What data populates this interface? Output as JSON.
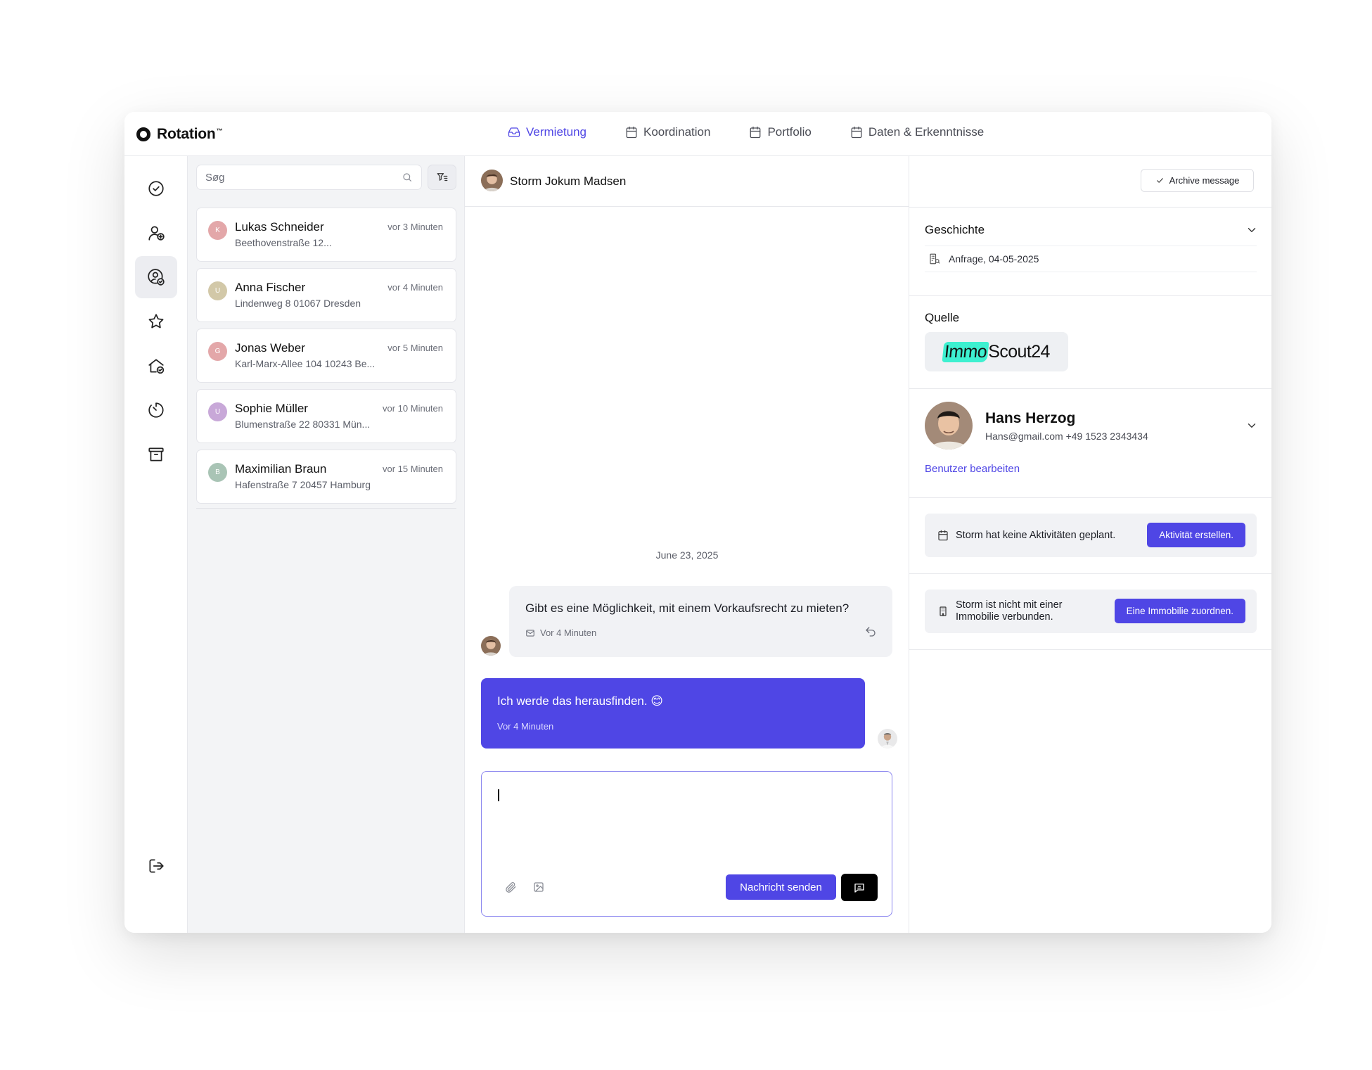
{
  "app": {
    "name": "Rotation",
    "trademark": "™"
  },
  "nav": {
    "tabs": [
      {
        "label": "Vermietung",
        "icon": "inbox-icon",
        "active": true
      },
      {
        "label": "Koordination",
        "icon": "calendar-icon",
        "active": false
      },
      {
        "label": "Portfolio",
        "icon": "calendar-icon",
        "active": false
      },
      {
        "label": "Daten & Erkenntnisse",
        "icon": "calendar-icon",
        "active": false
      }
    ]
  },
  "rail": {
    "icons": [
      "check-circle-icon",
      "user-add-icon",
      "user-check-icon",
      "star-icon",
      "home-check-icon",
      "timer-icon",
      "archive-icon",
      "logout-icon"
    ],
    "active_index": 2
  },
  "search": {
    "placeholder": "Søg"
  },
  "conversations": [
    {
      "initial": "K",
      "avatar_color": "#e3a7a9",
      "name": "Lukas Schneider",
      "address": "Beethovenstraße 12...",
      "time": "vor 3 Minuten"
    },
    {
      "initial": "U",
      "avatar_color": "#d2c8a8",
      "name": "Anna Fischer",
      "address": "Lindenweg 8 01067 Dresden",
      "time": "vor 4 Minuten"
    },
    {
      "initial": "G",
      "avatar_color": "#e3a7a9",
      "name": "Jonas Weber",
      "address": "Karl-Marx-Allee 104 10243 Be...",
      "time": "vor 5 Minuten"
    },
    {
      "initial": "U",
      "avatar_color": "#c8a8d8",
      "name": "Sophie Müller",
      "address": "Blumenstraße 22 80331 Mün...",
      "time": "vor 10 Minuten"
    },
    {
      "initial": "B",
      "avatar_color": "#a9c4b5",
      "name": "Maximilian Braun",
      "address": "Hafenstraße 7 20457 Hamburg",
      "time": "vor 15 Minuten"
    }
  ],
  "chat": {
    "contact_name": "Storm Jokum Madsen",
    "archive_label": "Archive message",
    "date": "June 23, 2025",
    "incoming": {
      "text": "Gibt es eine Möglichkeit, mit einem Vorkaufsrecht zu mieten?",
      "time": "Vor 4 Minuten"
    },
    "outgoing": {
      "text": "Ich werde das herausfinden. 😊",
      "time": "Vor 4 Minuten"
    },
    "composer": {
      "value": "",
      "send_label": "Nachricht senden"
    }
  },
  "panel": {
    "history": {
      "title": "Geschichte",
      "item": "Anfrage, 04-05-2025"
    },
    "source": {
      "title": "Quelle",
      "brand_part1": "Immo",
      "brand_part2": "Scout24"
    },
    "contact": {
      "name": "Hans Herzog",
      "email": "Hans@gmail.com",
      "phone": "+49 1523 2343434",
      "edit_label": "Benutzer bearbeiten"
    },
    "activity": {
      "text": "Storm hat keine Aktivitäten geplant.",
      "button": "Aktivität erstellen."
    },
    "property": {
      "text_line1": "Storm ist nicht mit einer",
      "text_line2": "Immobilie verbunden.",
      "button": "Eine Immobilie zuordnen."
    }
  },
  "colors": {
    "accent": "#4f46e5",
    "brand_highlight": "#3df0d0"
  }
}
